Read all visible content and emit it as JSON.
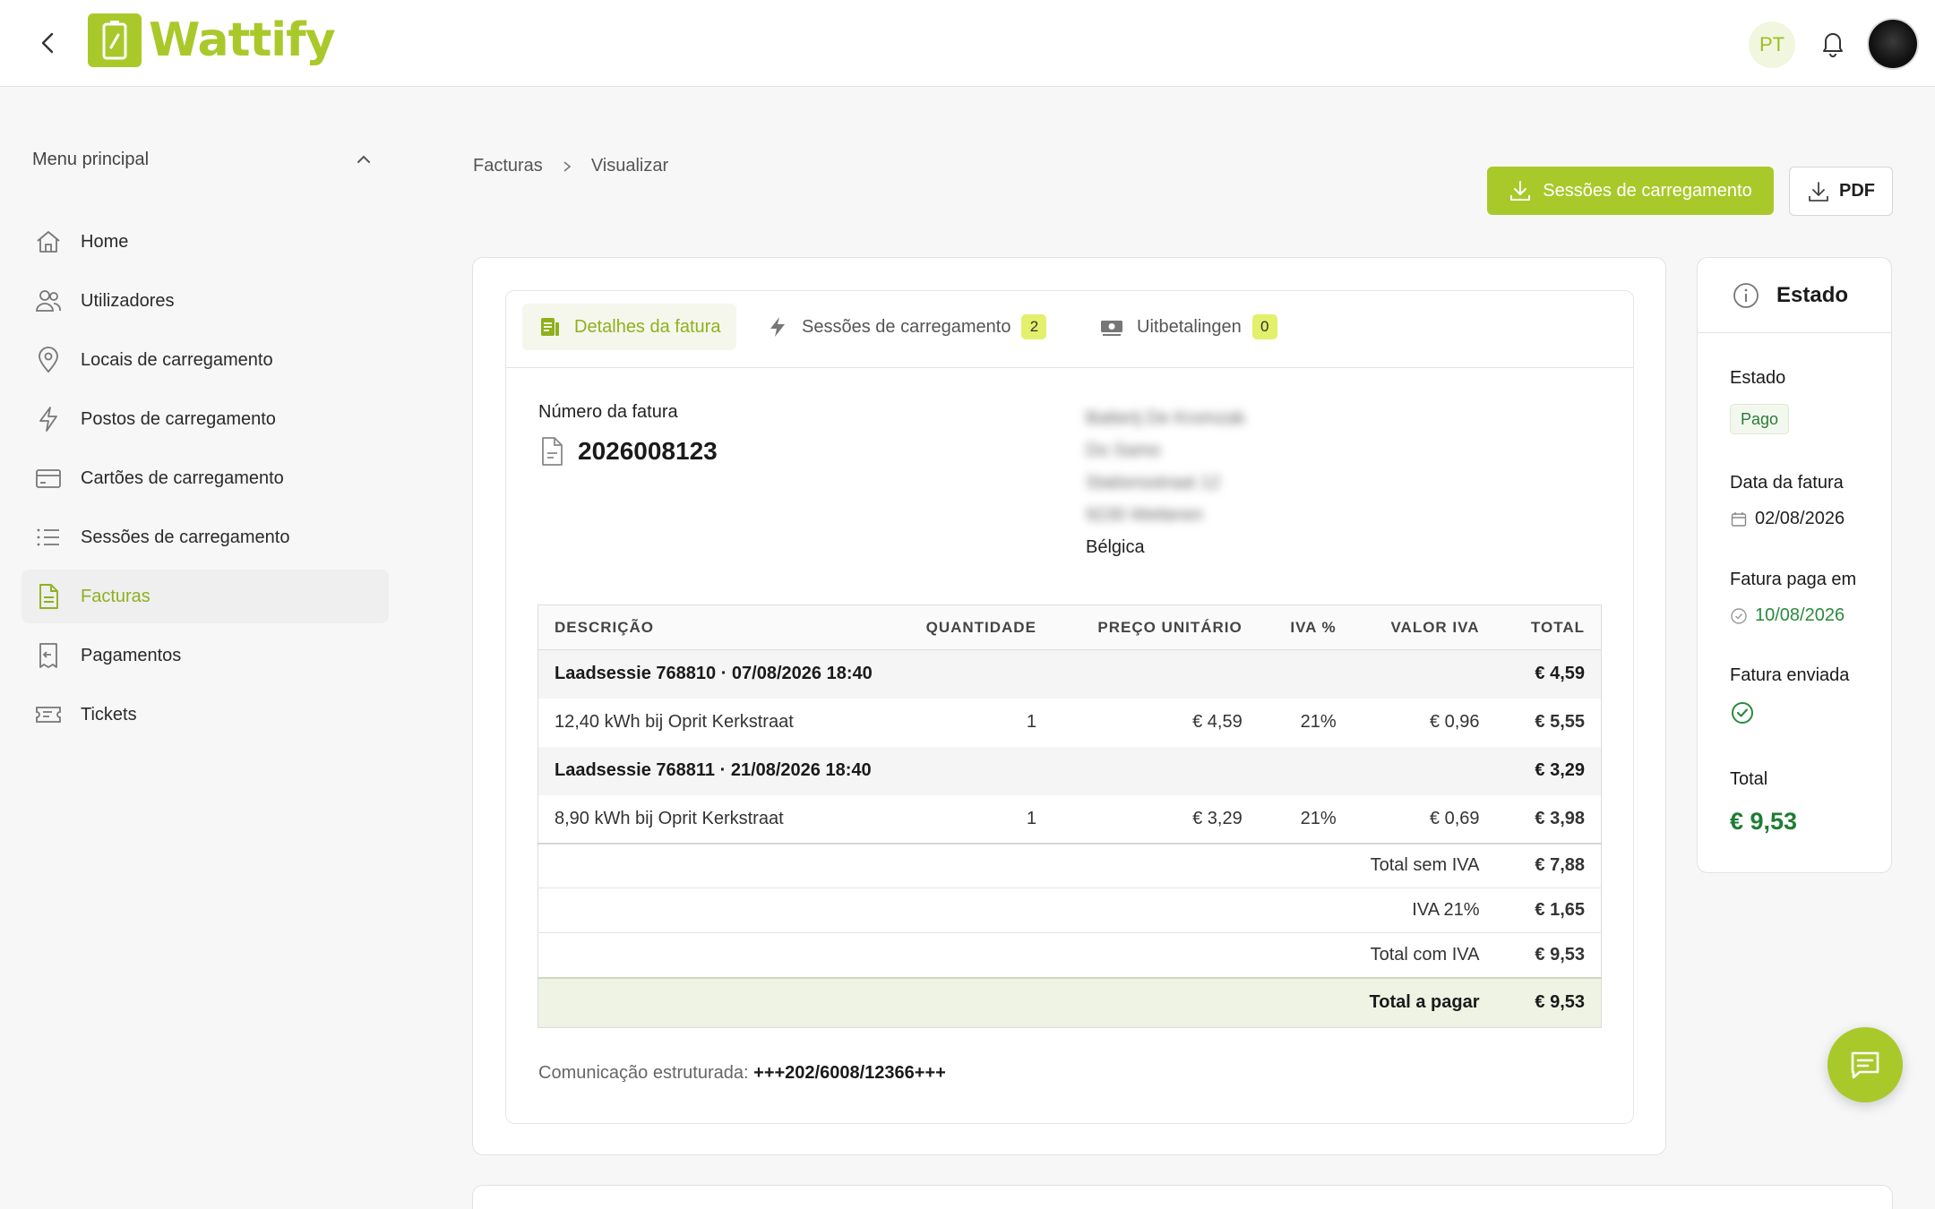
{
  "header": {
    "logo_text": "Wattify",
    "language": "PT"
  },
  "sidebar": {
    "title": "Menu principal",
    "items": [
      {
        "label": "Home",
        "icon": "home-icon"
      },
      {
        "label": "Utilizadores",
        "icon": "users-icon"
      },
      {
        "label": "Locais de carregamento",
        "icon": "location-pin-icon"
      },
      {
        "label": "Postos de carregamento",
        "icon": "lightning-icon"
      },
      {
        "label": "Cartões de carregamento",
        "icon": "credit-card-icon"
      },
      {
        "label": "Sessões de carregamento",
        "icon": "list-icon"
      },
      {
        "label": "Facturas",
        "icon": "invoice-document-icon",
        "active": true
      },
      {
        "label": "Pagamentos",
        "icon": "receipt-icon"
      },
      {
        "label": "Tickets",
        "icon": "ticket-icon"
      }
    ]
  },
  "breadcrumb": {
    "parent": "Facturas",
    "current": "Visualizar"
  },
  "actions": {
    "sessions_button": "Sessões de carregamento",
    "pdf_button": "PDF"
  },
  "tabs": [
    {
      "label": "Detalhes da fatura",
      "active": true
    },
    {
      "label": "Sessões de carregamento",
      "count": "2"
    },
    {
      "label": "Uitbetalingen",
      "count": "0"
    }
  ],
  "invoice": {
    "number_label": "Número da fatura",
    "number": "2026008123",
    "address": {
      "name": "Batterij De Kromzak",
      "company": "Do Samo",
      "street": "Stationsstraat 12",
      "city": "9230 Wetteren",
      "country": "Bélgica"
    }
  },
  "table": {
    "headers": {
      "description": "DESCRIÇÃO",
      "quantity": "QUANTIDADE",
      "unit_price": "PREÇO UNITÁRIO",
      "vat_pct": "IVA %",
      "vat_value": "VALOR IVA",
      "total": "TOTAL"
    },
    "groups": [
      {
        "title": "Laadsessie 768810 · 07/08/2026 18:40",
        "total": "€ 4,59",
        "line": {
          "description": "12,40 kWh bij Oprit Kerkstraat",
          "quantity": "1",
          "unit_price": "€ 4,59",
          "vat_pct": "21%",
          "vat_value": "€ 0,96",
          "total": "€ 5,55"
        }
      },
      {
        "title": "Laadsessie 768811 · 21/08/2026 18:40",
        "total": "€ 3,29",
        "line": {
          "description": "8,90 kWh bij Oprit Kerkstraat",
          "quantity": "1",
          "unit_price": "€ 3,29",
          "vat_pct": "21%",
          "vat_value": "€ 0,69",
          "total": "€ 3,98"
        }
      }
    ],
    "summary": {
      "excl_vat_label": "Total sem IVA",
      "excl_vat": "€ 7,88",
      "vat_label": "IVA 21%",
      "vat": "€ 1,65",
      "incl_vat_label": "Total com IVA",
      "incl_vat": "€ 9,53",
      "due_label": "Total a pagar",
      "due": "€ 9,53"
    }
  },
  "structured_comm": {
    "label": "Comunicação estruturada:",
    "value": "+++202/6008/12366+++"
  },
  "status_panel": {
    "title": "Estado",
    "status_label": "Estado",
    "status_value": "Pago",
    "invoice_date_label": "Data da fatura",
    "invoice_date": "02/08/2026",
    "paid_on_label": "Fatura paga em",
    "paid_on": "10/08/2026",
    "sent_label": "Fatura enviada",
    "total_label": "Total",
    "total": "€ 9,53"
  },
  "colors": {
    "accent": "#a9c92b",
    "accent_text": "#8fb01e",
    "success": "#2a8a3e"
  }
}
